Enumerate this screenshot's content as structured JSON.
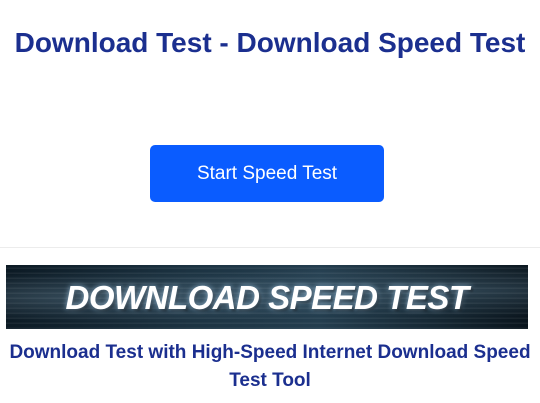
{
  "page": {
    "title": "Download Test - Download Speed Test",
    "start_button_label": "Start Speed Test",
    "banner_text": "DOWNLOAD SPEED TEST",
    "caption": "Download Test with High-Speed Internet Download Speed Test Tool"
  },
  "colors": {
    "title": "#1b2f8f",
    "button_bg": "#0a5cff",
    "button_text": "#ffffff"
  }
}
